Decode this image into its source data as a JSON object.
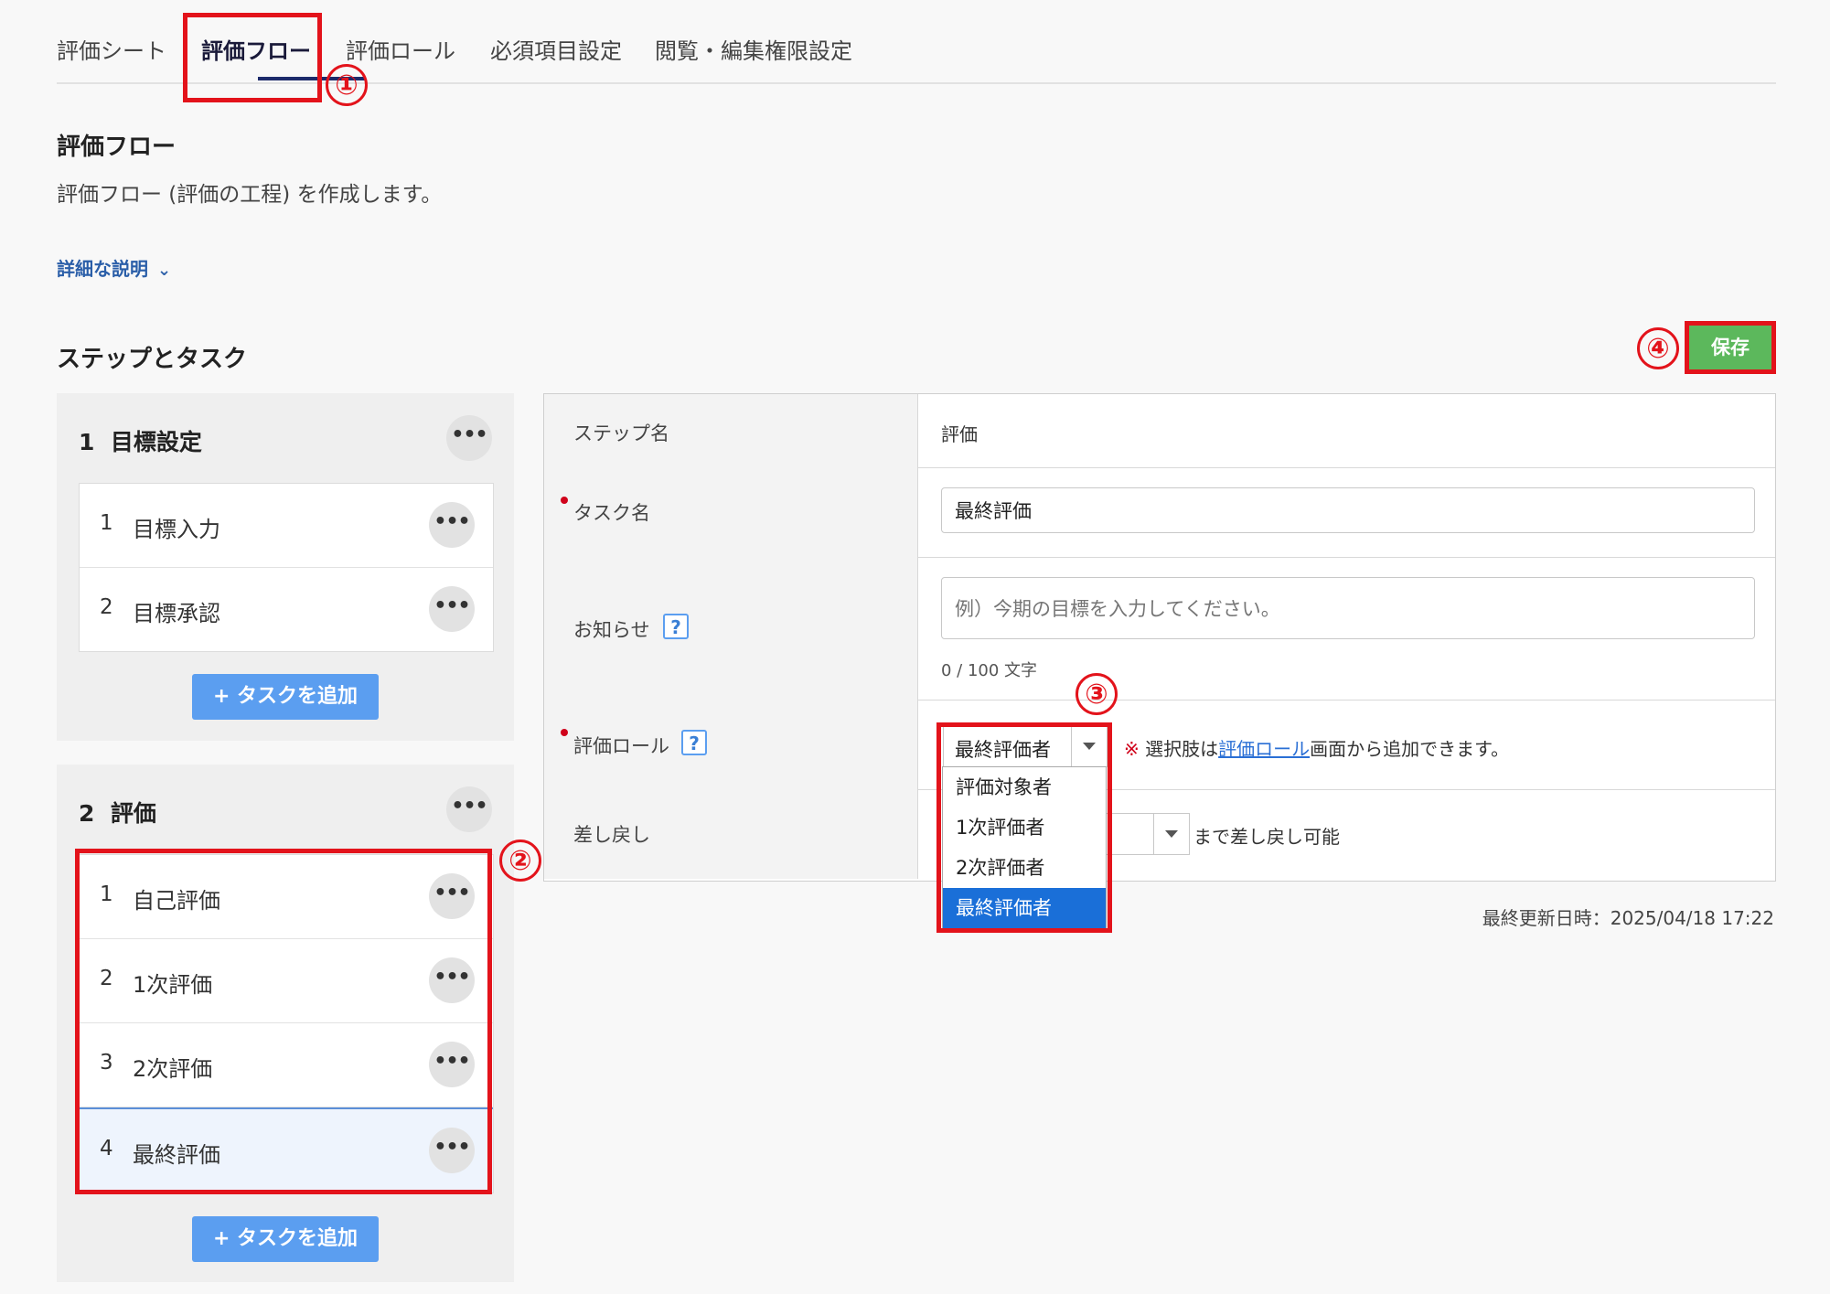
{
  "tabs": [
    {
      "label": "評価シート"
    },
    {
      "label": "評価フロー"
    },
    {
      "label": "評価ロール"
    },
    {
      "label": "必須項目設定"
    },
    {
      "label": "閲覧・編集権限設定"
    }
  ],
  "header": {
    "title": "評価フロー",
    "description": "評価フロー (評価の工程) を作成します。",
    "detail_link": "詳細な説明"
  },
  "steps_section": {
    "title": "ステップとタスク",
    "save_label": "保存",
    "add_task_label": "+ タスクを追加",
    "more_label": "•••"
  },
  "steps": [
    {
      "number": "1",
      "name": "目標設定",
      "tasks": [
        {
          "number": "1",
          "name": "目標入力"
        },
        {
          "number": "2",
          "name": "目標承認"
        }
      ]
    },
    {
      "number": "2",
      "name": "評価",
      "tasks": [
        {
          "number": "1",
          "name": "自己評価"
        },
        {
          "number": "2",
          "name": "1次評価"
        },
        {
          "number": "3",
          "name": "2次評価"
        },
        {
          "number": "4",
          "name": "最終評価"
        }
      ]
    }
  ],
  "form": {
    "step_name_label": "ステップ名",
    "step_name_value": "評価",
    "task_name_label": "タスク名",
    "task_name_value": "最終評価",
    "notice_label": "お知らせ",
    "notice_placeholder": "例）今期の目標を入力してください。",
    "notice_counter": "0 / 100 文字",
    "role_label": "評価ロール",
    "role_selected": "最終評価者",
    "role_note_mark": "※",
    "role_note_pre": " 選択肢は",
    "role_note_link": "評価ロール",
    "role_note_post": "画面から追加できます。",
    "sendback_label": "差し戻し",
    "sendback_suffix": "まで差し戻し可能",
    "help_label": "?"
  },
  "role_options": [
    "評価対象者",
    "1次評価者",
    "2次評価者",
    "最終評価者"
  ],
  "updated": "最終更新日時：2025/04/18 17:22",
  "callouts": [
    "①",
    "②",
    "③",
    "④"
  ],
  "colors": {
    "highlight": "#e3131b",
    "save": "#5cb85c",
    "add_task": "#5b9ef0",
    "selected_option": "#1a6fd8"
  }
}
